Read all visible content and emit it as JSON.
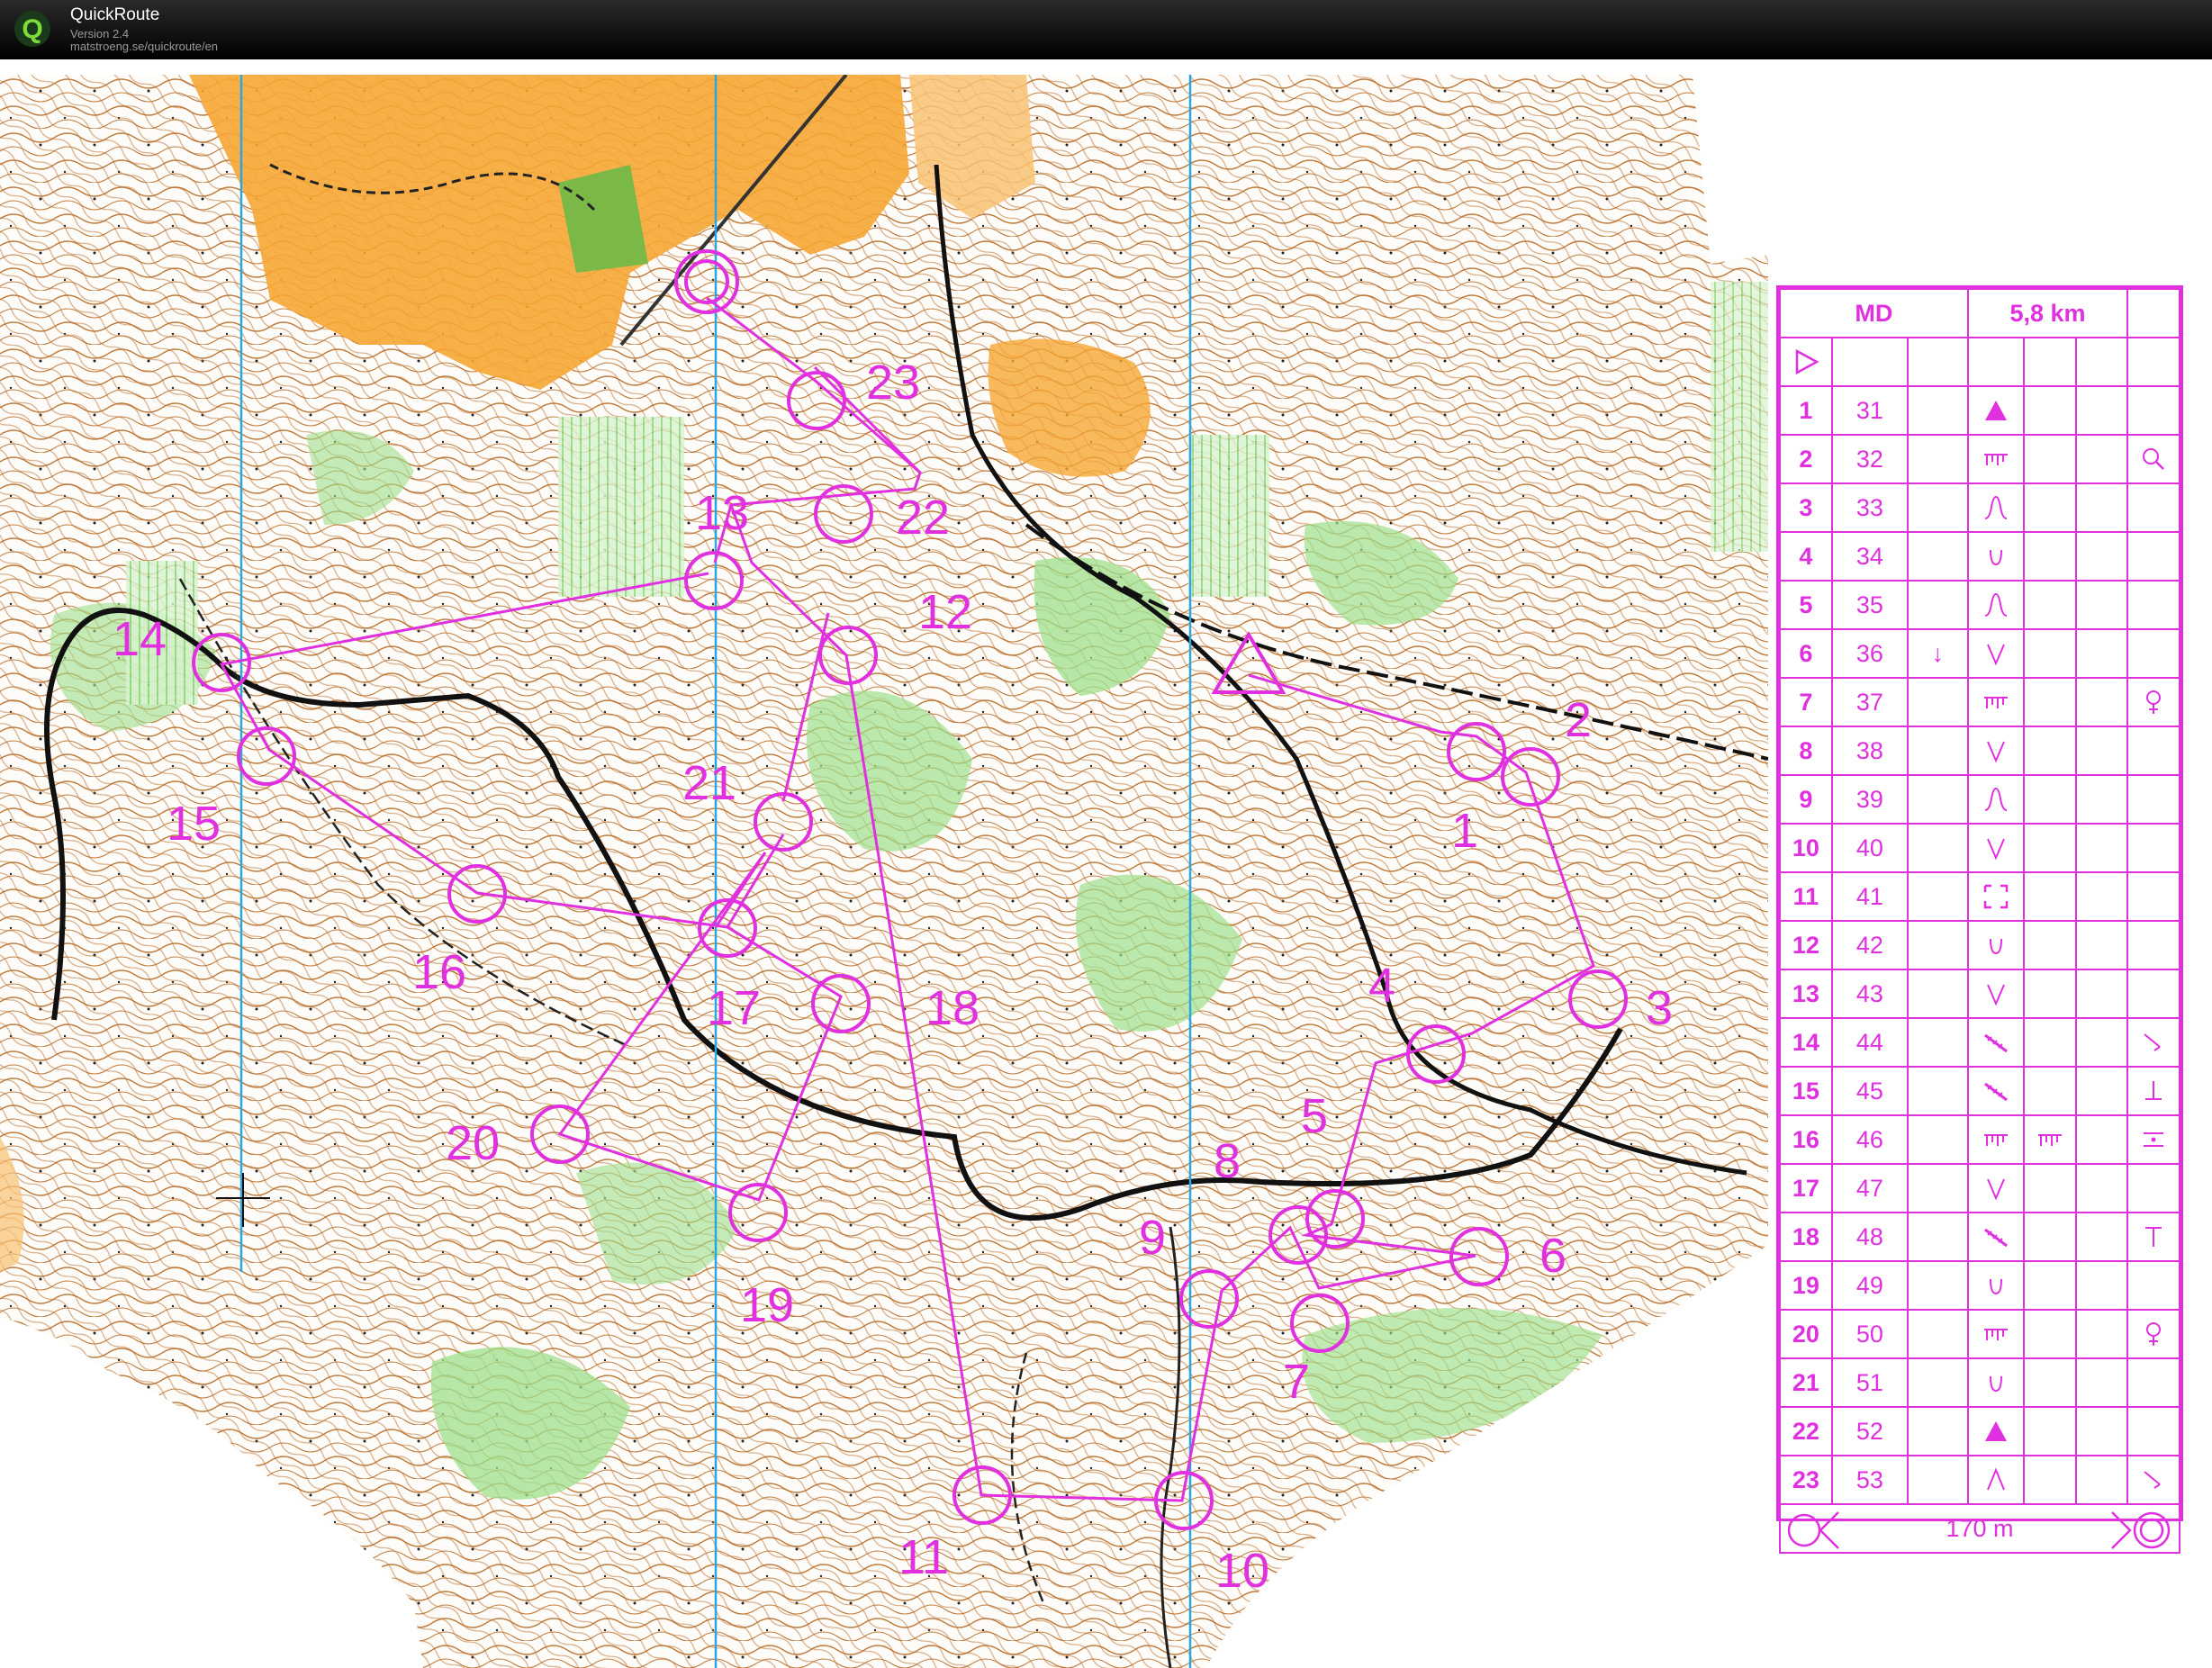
{
  "app": {
    "name": "QuickRoute",
    "version": "Version 2.4",
    "url": "matstroeng.se/quickroute/en",
    "logo_icon": "quickroute-q-icon",
    "logo_letter": "Q"
  },
  "colors": {
    "course": "#e030e0",
    "open_land": "#f6a634",
    "vegetation": "#9ee08c",
    "contour": "#b86a2a",
    "water_line": "#2aa7e0"
  },
  "map": {
    "start_icon": "start-triangle-icon",
    "finish_icon": "finish-double-circle-icon",
    "control_labels": [
      "1",
      "2",
      "3",
      "4",
      "5",
      "6",
      "7",
      "8",
      "9",
      "10",
      "11",
      "12",
      "13",
      "14",
      "15",
      "16",
      "17",
      "18",
      "19",
      "20",
      "21",
      "22",
      "23"
    ]
  },
  "card": {
    "class_name": "MD",
    "length": "5,8 km",
    "start_icon": "start-triangle-icon",
    "rows": [
      {
        "n": "1",
        "code": "31",
        "dir": "",
        "feature": "triangle-icon",
        "extra": ""
      },
      {
        "n": "2",
        "code": "32",
        "dir": "",
        "feature": "ruined-wall-icon",
        "extra": "search-lens-icon"
      },
      {
        "n": "3",
        "code": "33",
        "dir": "",
        "feature": "spur-icon",
        "extra": ""
      },
      {
        "n": "4",
        "code": "34",
        "dir": "",
        "feature": "depression-icon",
        "extra": ""
      },
      {
        "n": "5",
        "code": "35",
        "dir": "",
        "feature": "spur-icon",
        "extra": ""
      },
      {
        "n": "6",
        "code": "36",
        "dir": "↓",
        "feature": "re-entrant-icon",
        "extra": ""
      },
      {
        "n": "7",
        "code": "37",
        "dir": "",
        "feature": "ruined-wall-icon",
        "extra": "female-sign-icon"
      },
      {
        "n": "8",
        "code": "38",
        "dir": "",
        "feature": "re-entrant-icon",
        "extra": ""
      },
      {
        "n": "9",
        "code": "39",
        "dir": "",
        "feature": "spur-icon",
        "extra": ""
      },
      {
        "n": "10",
        "code": "40",
        "dir": "",
        "feature": "re-entrant-icon",
        "extra": ""
      },
      {
        "n": "11",
        "code": "41",
        "dir": "",
        "feature": "dashed-square-icon",
        "extra": ""
      },
      {
        "n": "12",
        "code": "42",
        "dir": "",
        "feature": "depression-icon",
        "extra": ""
      },
      {
        "n": "13",
        "code": "43",
        "dir": "",
        "feature": "re-entrant-icon",
        "extra": ""
      },
      {
        "n": "14",
        "code": "44",
        "dir": "",
        "feature": "slope-bar-icon",
        "extra": "corner-icon"
      },
      {
        "n": "15",
        "code": "45",
        "dir": "",
        "feature": "slope-bar-icon",
        "extra": "foot-icon"
      },
      {
        "n": "16",
        "code": "46",
        "dir": "",
        "feature": "ruined-wall-icon",
        "extra": "between-icon"
      },
      {
        "n": "17",
        "code": "47",
        "dir": "",
        "feature": "re-entrant-icon",
        "extra": ""
      },
      {
        "n": "18",
        "code": "48",
        "dir": "",
        "feature": "slope-bar-icon",
        "extra": "top-icon"
      },
      {
        "n": "19",
        "code": "49",
        "dir": "",
        "feature": "depression-icon",
        "extra": ""
      },
      {
        "n": "20",
        "code": "50",
        "dir": "",
        "feature": "ruined-wall-icon",
        "extra": "female-sign-icon"
      },
      {
        "n": "21",
        "code": "51",
        "dir": "",
        "feature": "depression-icon",
        "extra": ""
      },
      {
        "n": "22",
        "code": "52",
        "dir": "",
        "feature": "triangle-icon",
        "extra": ""
      },
      {
        "n": "23",
        "code": "53",
        "dir": "",
        "feature": "peak-icon",
        "extra": "corner-icon"
      }
    ],
    "finish_distance": "170 m",
    "finish_left_icon": "funnel-left-icon",
    "finish_right_icon": "finish-double-circle-icon"
  }
}
